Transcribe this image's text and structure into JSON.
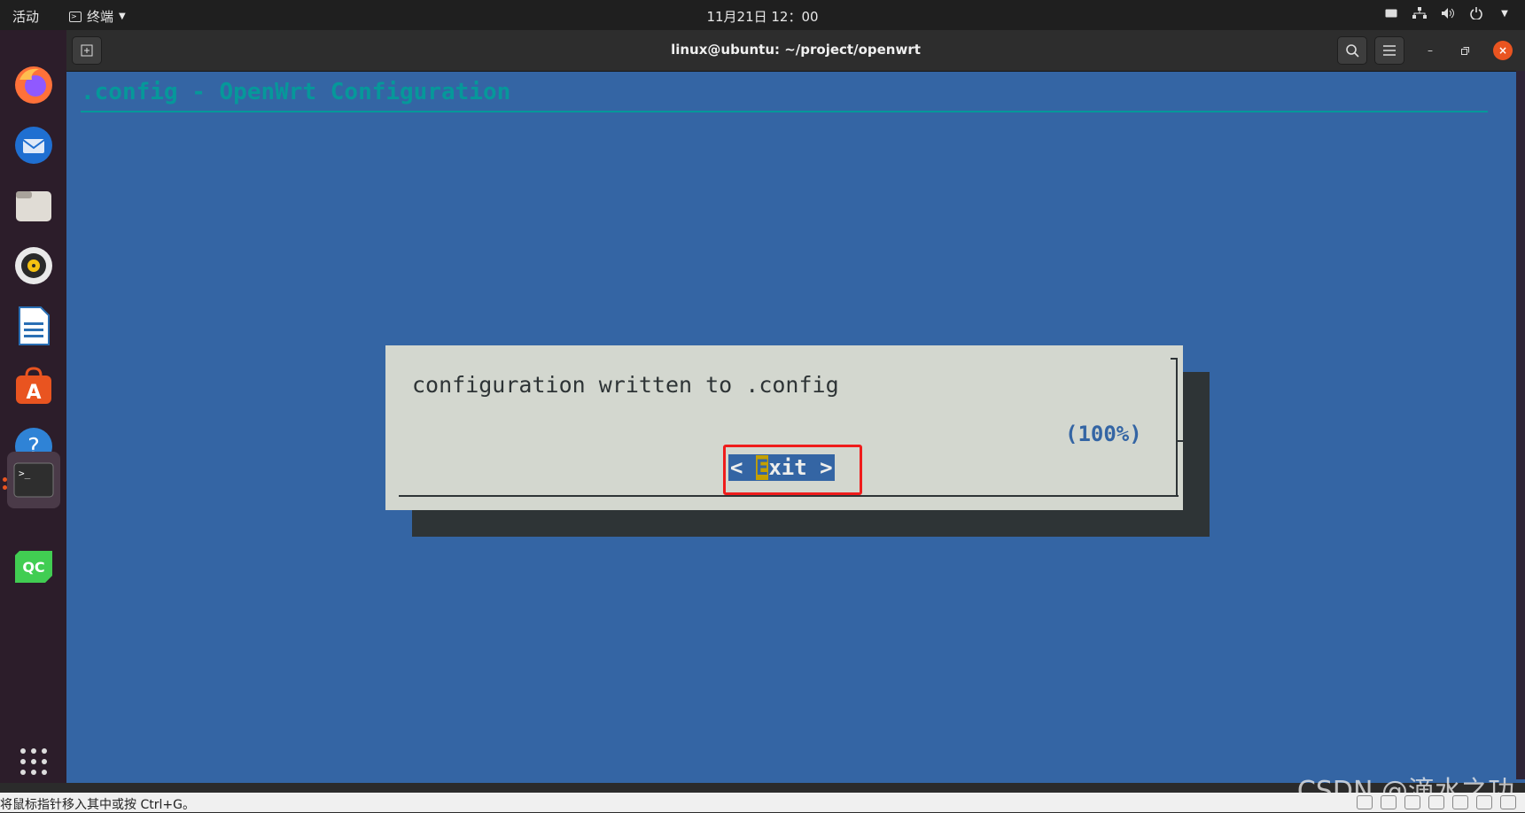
{
  "topbar": {
    "activities": "活动",
    "app_menu": "终端",
    "clock": "11月21日 12：00"
  },
  "dock": {
    "icons": [
      "firefox-icon",
      "thunderbird-icon",
      "files-icon",
      "rhythmbox-icon",
      "writer-icon",
      "software-icon",
      "help-icon",
      "terminal-icon",
      "qtcreator-icon",
      "app-grid-icon"
    ]
  },
  "window": {
    "title": "linux@ubuntu: ~/project/openwrt"
  },
  "terminal": {
    "menu_title": ".config - OpenWrt Configuration",
    "dialog_message": "configuration written to .config",
    "progress": "(100%)",
    "exit_left": "< ",
    "exit_hot": "E",
    "exit_rest": "xit >"
  },
  "statusbar": {
    "hint": "将鼠标指针移入其中或按 Ctrl+G。"
  },
  "watermark": "CSDN @滴水之功",
  "colors": {
    "terminal_bg": "#3465a4",
    "dialog_bg": "#d3d7cf",
    "title_cyan": "#06989a",
    "highlight_red": "#ef1c1c",
    "hotkey_yellow": "#c4a000"
  }
}
